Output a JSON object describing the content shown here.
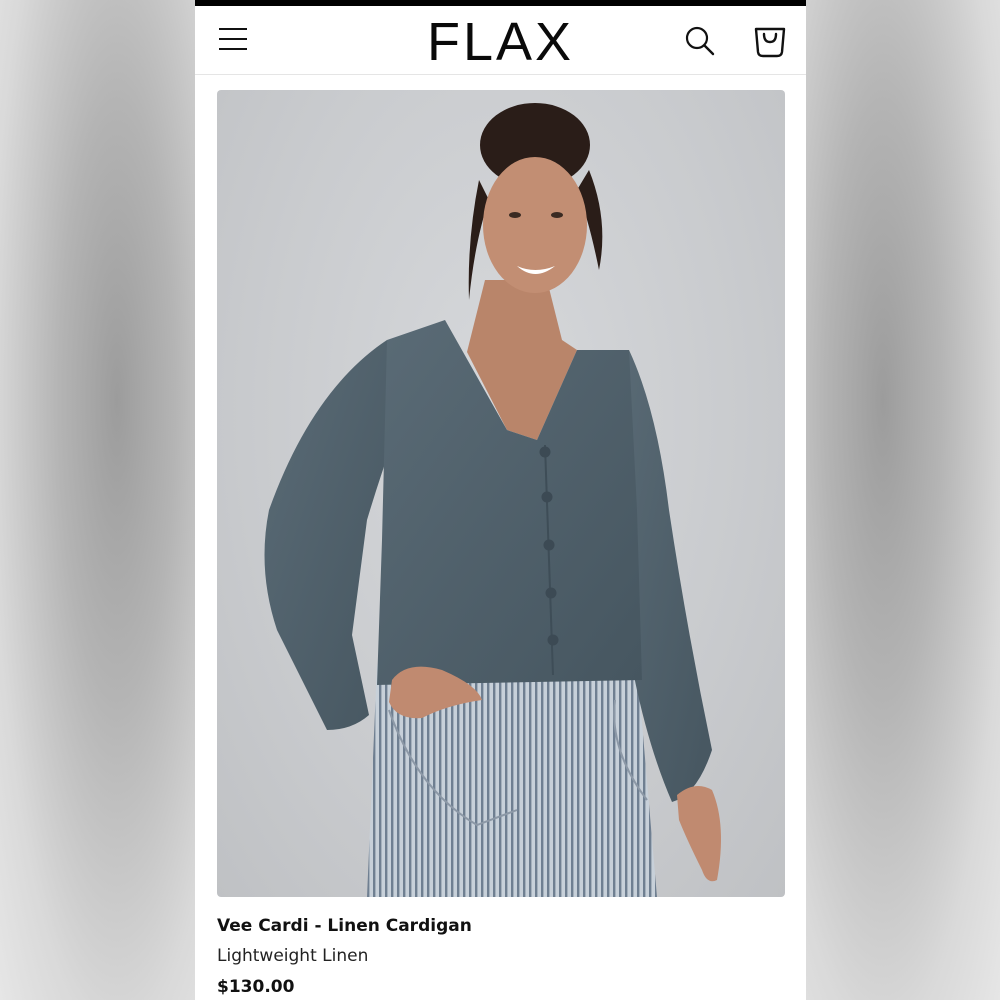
{
  "header": {
    "logo": "FLAX",
    "menu_icon": "hamburger-menu-icon",
    "search_icon": "search-icon",
    "cart_icon": "shopping-bag-icon"
  },
  "product": {
    "title": "Vee Cardi - Linen Cardigan",
    "subtitle": "Lightweight Linen",
    "price": "$130.00"
  },
  "colors": {
    "top_bar": "#000000",
    "background": "#ffffff",
    "cardigan": "#4e5f6a",
    "pants_stripe": "#7f8fa0"
  }
}
